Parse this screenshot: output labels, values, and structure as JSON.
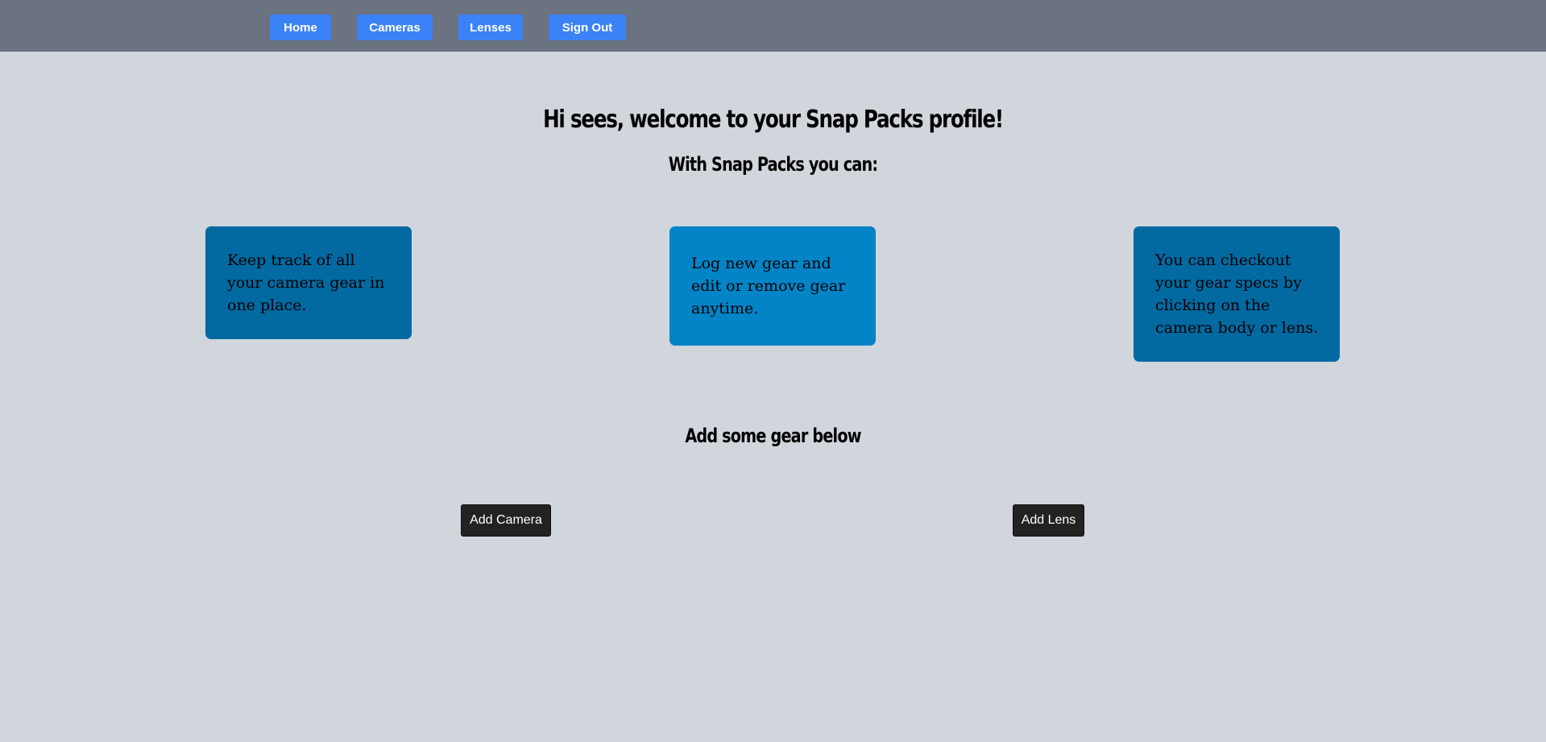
{
  "nav": {
    "items": [
      {
        "label": "Home"
      },
      {
        "label": "Cameras"
      },
      {
        "label": "Lenses"
      },
      {
        "label": "Sign Out"
      }
    ]
  },
  "main": {
    "welcome": "Hi sees, welcome to your Snap Packs profile!",
    "subtitle": "With Snap Packs you can:",
    "features": [
      {
        "text": "Keep track of all your camera gear in one place."
      },
      {
        "text": "Log new gear and edit or remove gear anytime."
      },
      {
        "text": "You can checkout your gear specs by clicking on the camera body or lens."
      }
    ],
    "add_heading": "Add some gear below",
    "add_camera_label": "Add Camera",
    "add_lens_label": "Add Lens"
  },
  "colors": {
    "background": "#d1d5dc",
    "navbar": "#6b7280",
    "nav_button": "#3b82f6",
    "card_dark": "#0369a1",
    "card_light": "#0284c7",
    "action_button": "#222222"
  }
}
